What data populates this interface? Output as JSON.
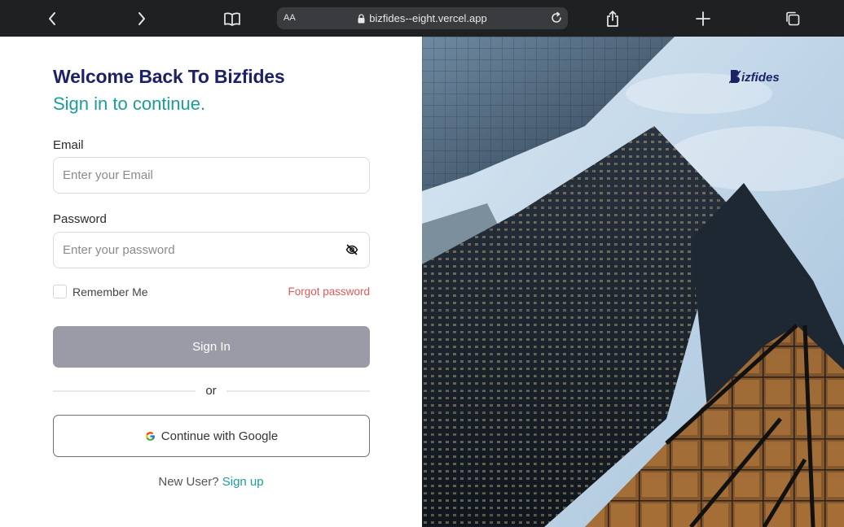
{
  "browser": {
    "aa_label": "AA",
    "url": "bizfides--eight.vercel.app",
    "icons": [
      "back-icon",
      "forward-icon",
      "book-icon",
      "lock-icon",
      "reload-icon",
      "share-icon",
      "plus-icon",
      "tabs-icon"
    ]
  },
  "login": {
    "title": "Welcome Back To Bizfides",
    "subtitle": "Sign in to continue.",
    "email_label": "Email",
    "email_placeholder": "Enter your Email",
    "email_value": "",
    "password_label": "Password",
    "password_placeholder": "Enter your password",
    "password_value": "",
    "remember_label": "Remember Me",
    "remember_checked": false,
    "forgot_label": "Forgot password",
    "signin_label": "Sign In",
    "or_label": "or",
    "google_label": "Continue with Google",
    "new_user_text": "New User?",
    "signup_label": "Sign up"
  },
  "brand": {
    "logo_text": "izfides",
    "logo_letter": "B"
  },
  "colors": {
    "title": "#1d2267",
    "accent": "#1a9e97",
    "forgot": "#e15858",
    "signin_bg": "#9a9ba6",
    "toolbar_bg": "#1f2022"
  }
}
